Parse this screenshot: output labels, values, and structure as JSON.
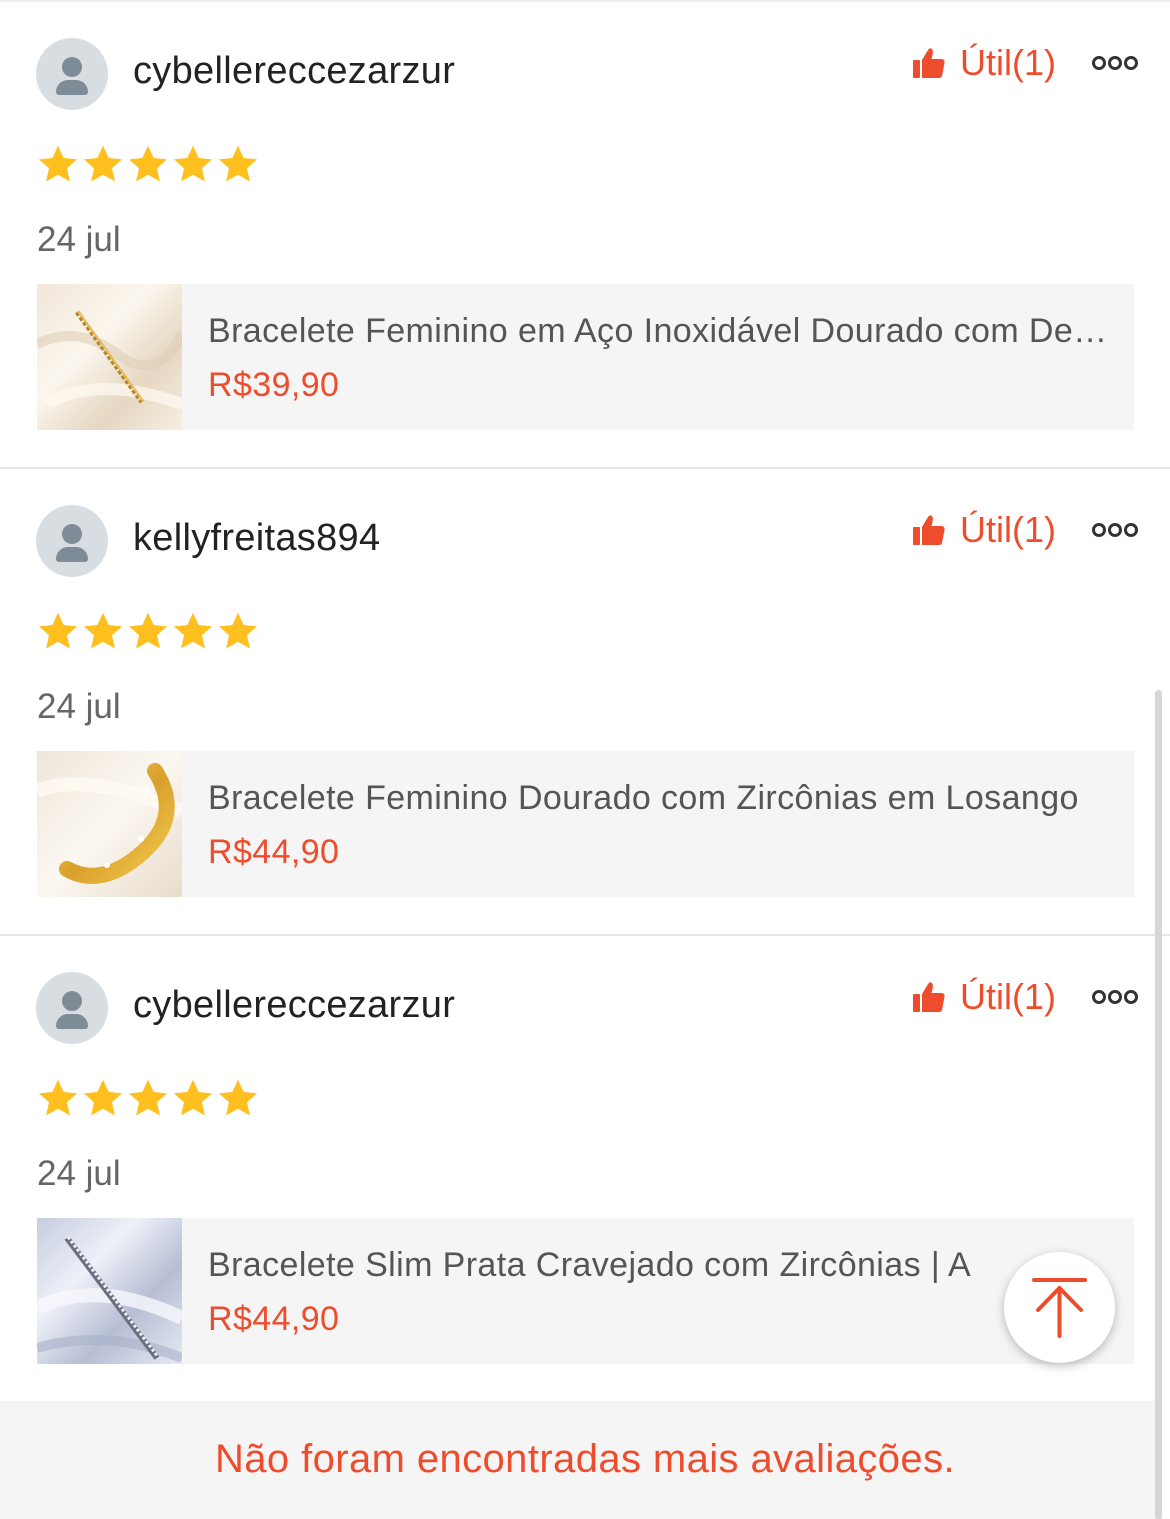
{
  "colors": {
    "accent": "#ee4d2d",
    "star": "#ffbf1e",
    "card_bg": "#f5f5f5",
    "avatar_bg": "#d8dde2"
  },
  "icons": {
    "helpful": "thumbs-up-icon",
    "more": "more-dots-icon",
    "star": "star-icon",
    "back_to_top": "arrow-up-icon",
    "avatar": "user-placeholder-icon"
  },
  "reviews": [
    {
      "username": "cybellereccezarzur",
      "rating": 5,
      "date": "24 jul",
      "helpful_label": "Útil(1)",
      "product": {
        "name": "Bracelete Feminino em Aço Inoxidável Dourado com Design Torcido",
        "price": "R$39,90"
      }
    },
    {
      "username": "kellyfreitas894",
      "rating": 5,
      "date": "24 jul",
      "helpful_label": "Útil(1)",
      "product": {
        "name": "Bracelete Feminino Dourado com Zircônias em Losango",
        "price": "R$44,90"
      }
    },
    {
      "username": "cybellereccezarzur",
      "rating": 5,
      "date": "24 jul",
      "helpful_label": "Útil(1)",
      "product": {
        "name": "Bracelete Slim Prata Cravejado com Zircônias | A",
        "price": "R$44,90"
      }
    }
  ],
  "footer": {
    "message": "Não foram encontradas mais avaliações."
  }
}
